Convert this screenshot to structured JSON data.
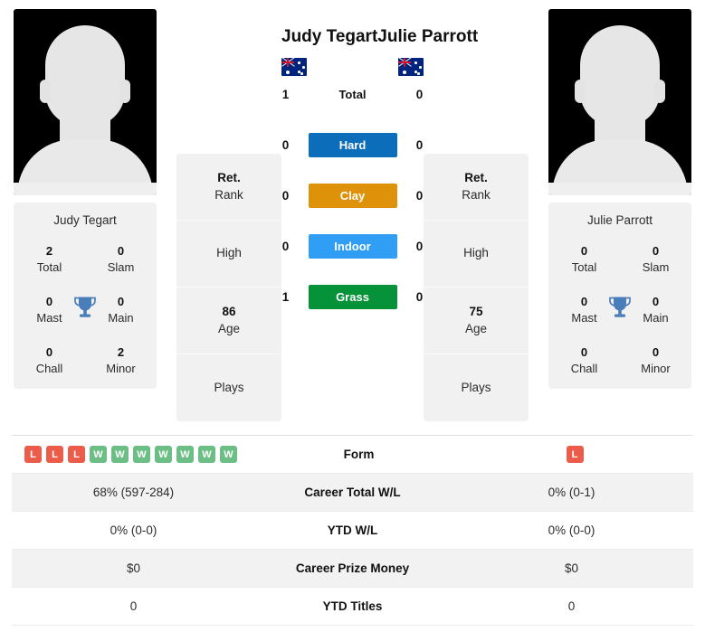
{
  "players": {
    "left": {
      "name": "Judy Tegart",
      "flag": "australia-flag",
      "avatar": "player-photo-placeholder",
      "titles": {
        "card_name": "Judy Tegart",
        "cells": [
          {
            "value": "2",
            "label": "Total"
          },
          {
            "value": "0",
            "label": "Slam"
          },
          {
            "value": "0",
            "label": "Mast"
          },
          {
            "value": "0",
            "label": "Main"
          },
          {
            "value": "0",
            "label": "Chall"
          },
          {
            "value": "2",
            "label": "Minor"
          }
        ]
      },
      "info": [
        {
          "value": "Ret.",
          "label": "Rank"
        },
        {
          "value": "",
          "label": "High"
        },
        {
          "value": "86",
          "label": "Age"
        },
        {
          "value": "",
          "label": "Plays"
        }
      ]
    },
    "right": {
      "name": "Julie Parrott",
      "flag": "australia-flag",
      "avatar": "player-photo-placeholder",
      "titles": {
        "card_name": "Julie Parrott",
        "cells": [
          {
            "value": "0",
            "label": "Total"
          },
          {
            "value": "0",
            "label": "Slam"
          },
          {
            "value": "0",
            "label": "Mast"
          },
          {
            "value": "0",
            "label": "Main"
          },
          {
            "value": "0",
            "label": "Chall"
          },
          {
            "value": "0",
            "label": "Minor"
          }
        ]
      },
      "info": [
        {
          "value": "Ret.",
          "label": "Rank"
        },
        {
          "value": "",
          "label": "High"
        },
        {
          "value": "75",
          "label": "Age"
        },
        {
          "value": "",
          "label": "Plays"
        }
      ]
    }
  },
  "head_to_head": [
    {
      "left": "1",
      "label": "Total",
      "right": "0",
      "color": "",
      "text_color": ""
    },
    {
      "left": "0",
      "label": "Hard",
      "right": "0",
      "color": "#0c6eba",
      "text_color": "#ffffff"
    },
    {
      "left": "0",
      "label": "Clay",
      "right": "0",
      "color": "#dd9209",
      "text_color": "#ffffff"
    },
    {
      "left": "0",
      "label": "Indoor",
      "right": "0",
      "color": "#2f9ef4",
      "text_color": "#ffffff"
    },
    {
      "left": "1",
      "label": "Grass",
      "right": "0",
      "color": "#069239",
      "text_color": "#ffffff"
    }
  ],
  "stats_table": {
    "form_row": {
      "label": "Form",
      "left_badges": [
        "L",
        "L",
        "L",
        "W",
        "W",
        "W",
        "W",
        "W",
        "W",
        "W"
      ],
      "right_badges": [
        "L"
      ]
    },
    "rows": [
      {
        "left": "68% (597-284)",
        "label": "Career Total W/L",
        "right": "0% (0-1)"
      },
      {
        "left": "0% (0-0)",
        "label": "YTD W/L",
        "right": "0% (0-0)"
      },
      {
        "left": "$0",
        "label": "Career Prize Money",
        "right": "$0"
      },
      {
        "left": "0",
        "label": "YTD Titles",
        "right": "0"
      }
    ]
  },
  "colors": {
    "win_badge": "#6cbf84",
    "loss_badge": "#eb5c4b",
    "trophy": "#4a7ebb",
    "card_bg": "#f1f1f1",
    "row_shade": "#f2f2f2"
  }
}
